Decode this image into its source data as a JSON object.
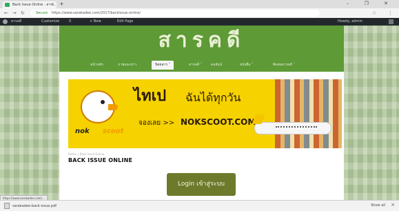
{
  "browser": {
    "tab_title": "Back Issue Online - สาร...",
    "tab_close": "×",
    "new_tab": "+",
    "window_controls": "– ❐ ✕",
    "back": "←",
    "forward": "→",
    "reload": "↻",
    "url_secure": "Secure",
    "url": "https://www.sarakadee.com/2017/backissue-online/",
    "bookmark_star": "☆",
    "menu_dots": "⋮"
  },
  "wp_admin_bar": {
    "site_name": "สารคดี",
    "customize": "Customize",
    "comments": "0",
    "new": "+ New",
    "edit": "Edit Page",
    "greeting": "Howdy, admin"
  },
  "site": {
    "logo_text": "สารคดี",
    "menu": [
      {
        "label": "หน้าหลัก"
      },
      {
        "label": "ภาพและข่าว"
      },
      {
        "label": "นิตยสาร ˅",
        "active": true
      },
      {
        "label": "สารคดี ˅"
      },
      {
        "label": "คอลัมน์"
      },
      {
        "label": "หนังสือ ˅"
      },
      {
        "label": "ติดต่อสารคดี ˅"
      }
    ]
  },
  "banner": {
    "headline": "ไทเป",
    "headline_sub": "ฉันได้ทุกวัน",
    "cta_thai": "จองเลย >>",
    "cta_url": "NOKSCOOT.COM",
    "brand_black": "nok",
    "brand_orange": "scoot"
  },
  "main": {
    "breadcrumb": "Home » Back Issue Online",
    "title": "BACK ISSUE ONLINE",
    "login_button": "Login เข้าสู่ระบบ"
  },
  "status": {
    "tooltip": "https://www.sarakadee.com/...",
    "download_item": "sarakadee-back-issue.pdf",
    "show_all": "Show all",
    "close": "×"
  }
}
